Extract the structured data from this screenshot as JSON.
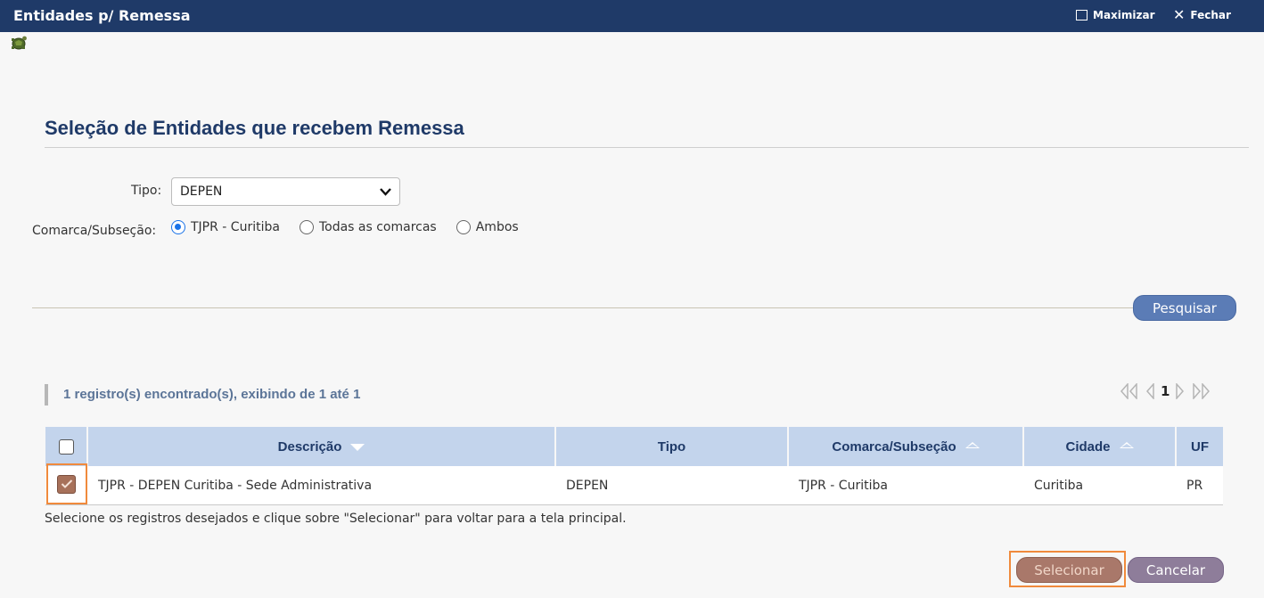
{
  "window": {
    "title": "Entidades p/ Remessa",
    "maximize_label": "Maximizar",
    "close_label": "Fechar"
  },
  "form": {
    "section_title": "Seleção de Entidades que recebem Remessa",
    "tipo_label": "Tipo:",
    "tipo_value": "DEPEN",
    "comarca_label": "Comarca/Subseção:",
    "radios": [
      {
        "label": "TJPR - Curitiba",
        "selected": true
      },
      {
        "label": "Todas as comarcas",
        "selected": false
      },
      {
        "label": "Ambos",
        "selected": false
      }
    ],
    "search_button": "Pesquisar"
  },
  "results": {
    "summary": "1 registro(s) encontrado(s), exibindo de 1 até 1",
    "current_page": "1",
    "columns": {
      "descricao": "Descrição",
      "tipo": "Tipo",
      "comarca": "Comarca/Subseção",
      "cidade": "Cidade",
      "uf": "UF"
    },
    "rows": [
      {
        "checked": true,
        "descricao": "TJPR - DEPEN Curitiba - Sede Administrativa",
        "tipo": "DEPEN",
        "comarca": "TJPR - Curitiba",
        "cidade": "Curitiba",
        "uf": "PR"
      }
    ],
    "hint": "Selecione os registros desejados e clique sobre \"Selecionar\" para voltar para a tela principal."
  },
  "actions": {
    "select_label": "Selecionar",
    "cancel_label": "Cancelar"
  },
  "colors": {
    "titlebar": "#1f3a68",
    "accent": "#5b7cb6",
    "highlight": "#f08a3c"
  }
}
